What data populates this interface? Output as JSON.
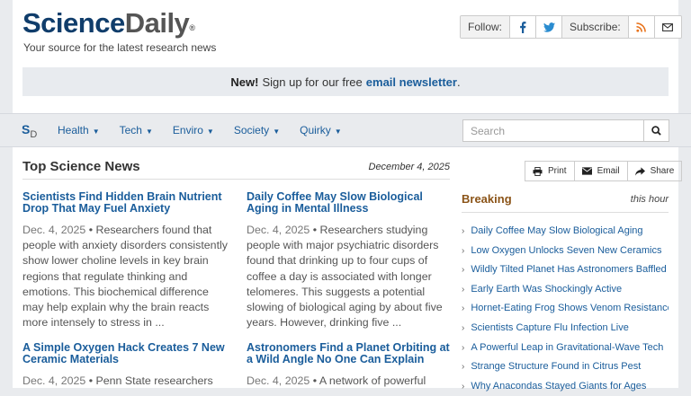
{
  "header": {
    "logo_part1": "Science",
    "logo_part2": "Daily",
    "logo_mark": "®",
    "tagline": "Your source for the latest research news"
  },
  "social": {
    "follow_label": "Follow:",
    "subscribe_label": "Subscribe:",
    "icons": [
      "facebook-icon",
      "twitter-icon",
      "rss-icon",
      "email-icon"
    ]
  },
  "newsletter": {
    "new_label": "New!",
    "text": "Sign up for our free",
    "link": "email newsletter",
    "end": "."
  },
  "nav": {
    "logo_s": "S",
    "logo_d": "D",
    "items": [
      "Health",
      "Tech",
      "Enviro",
      "Society",
      "Quirky"
    ],
    "search_placeholder": "Search"
  },
  "main": {
    "heading": "Top Science News",
    "date": "December 4, 2025",
    "stories": [
      {
        "title": "Scientists Find Hidden Brain Nutrient Drop That May Fuel Anxiety",
        "date": "Dec. 4, 2025",
        "summary": "Researchers found that people with anxiety disorders consistently show lower choline levels in key brain regions that regulate thinking and emotions. This biochemical difference may help explain why the brain reacts more intensely to stress in ..."
      },
      {
        "title": "Daily Coffee May Slow Biological Aging in Mental Illness",
        "date": "Dec. 4, 2025",
        "summary": "Researchers studying people with major psychiatric disorders found that drinking up to four cups of coffee a day is associated with longer telomeres. This suggests a potential slowing of biological aging by about five years. However, drinking five ..."
      },
      {
        "title": "A Simple Oxygen Hack Creates 7 New Ceramic Materials",
        "date": "Dec. 4, 2025",
        "summary": "Penn State researchers"
      },
      {
        "title": "Astronomers Find a Planet Orbiting at a Wild Angle No One Can Explain",
        "date": "Dec. 4, 2025",
        "summary": "A network of powerful"
      }
    ]
  },
  "share": {
    "print": "Print",
    "email": "Email",
    "share": "Share"
  },
  "breaking": {
    "heading": "Breaking",
    "subheading": "this hour",
    "items": [
      "Daily Coffee May Slow Biological Aging",
      "Low Oxygen Unlocks Seven New Ceramics",
      "Wildly Tilted Planet Has Astronomers Baffled",
      "Early Earth Was Shockingly Active",
      "Hornet-Eating Frog Shows Venom Resistance",
      "Scientists Capture Flu Infection Live",
      "A Powerful Leap in Gravitational-Wave Tech",
      "Strange Structure Found in Citrus Pest",
      "Why Anacondas Stayed Giants for Ages"
    ]
  },
  "colors": {
    "link": "#1a5d9b",
    "logo_blue": "#103d6b",
    "breaking_heading": "#8b5418",
    "nav_bg": "#e9ebee"
  }
}
